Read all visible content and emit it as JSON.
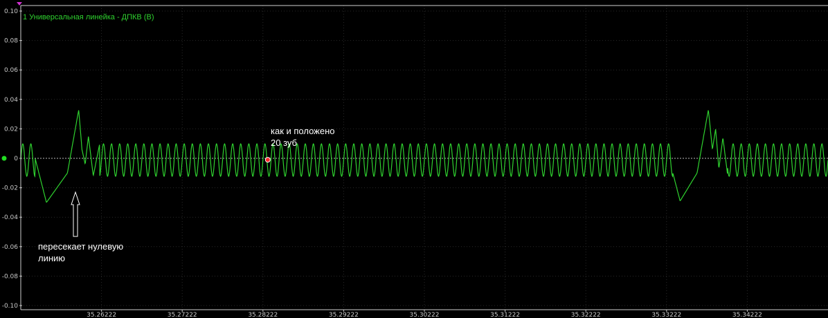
{
  "chart_data": {
    "type": "line",
    "title": "1 Универсальная линейка - ДПКВ (В)",
    "xlabel": "",
    "ylabel": "",
    "ylim": [
      -0.1,
      0.1
    ],
    "xlim": [
      35.25222,
      35.35222
    ],
    "y_ticks": [
      "0.10",
      "0.08",
      "0.06",
      "0.04",
      "0.02",
      "0",
      "-0.02",
      "-0.04",
      "-0.06",
      "-0.08",
      "-0.10"
    ],
    "x_ticks": [
      "35.26222",
      "35.27222",
      "35.28222",
      "35.29222",
      "35.30222",
      "35.31222",
      "35.32222",
      "35.33222",
      "35.34222"
    ],
    "grid": true,
    "zero_line": "dotted",
    "line_color": "#2fd22f",
    "series": [
      {
        "description_points": [
          [
            35.2522,
            0.0
          ],
          [
            35.2528,
            0.01
          ],
          [
            35.2532,
            -0.013
          ],
          [
            35.2536,
            0.01
          ],
          [
            35.254,
            0.0
          ],
          [
            35.2554,
            -0.03
          ],
          [
            35.258,
            -0.01
          ],
          [
            35.2594,
            0.033
          ],
          [
            35.2598,
            0.006
          ],
          [
            35.2602,
            -0.004
          ],
          [
            35.2606,
            0.015
          ],
          [
            35.2612,
            -0.012
          ],
          [
            35.262,
            0.01
          ],
          [
            35.333,
            -0.01
          ],
          [
            35.3339,
            -0.029
          ],
          [
            35.336,
            -0.01
          ],
          [
            35.3374,
            0.033
          ],
          [
            35.3379,
            0.006
          ],
          [
            35.3383,
            0.02
          ],
          [
            35.3387,
            -0.007
          ],
          [
            35.3392,
            0.014
          ],
          [
            35.3398,
            -0.012
          ],
          [
            35.3522,
            0.0
          ]
        ],
        "sinusoid_amplitude": 0.011,
        "sinusoid_period": 0.001
      }
    ]
  },
  "annotations": {
    "teeth_note": "как и положено\n20 зуб",
    "crossing_note": "пересекает нулевую\nлинию"
  },
  "colors": {
    "background": "#000000",
    "grid": "#2a2a2a",
    "axis_text": "#c8c8c8",
    "trace": "#2fd22f",
    "marker_red": "#ff2a2a",
    "marker_green": "#22dd22",
    "marker_magenta": "#d030d0"
  }
}
